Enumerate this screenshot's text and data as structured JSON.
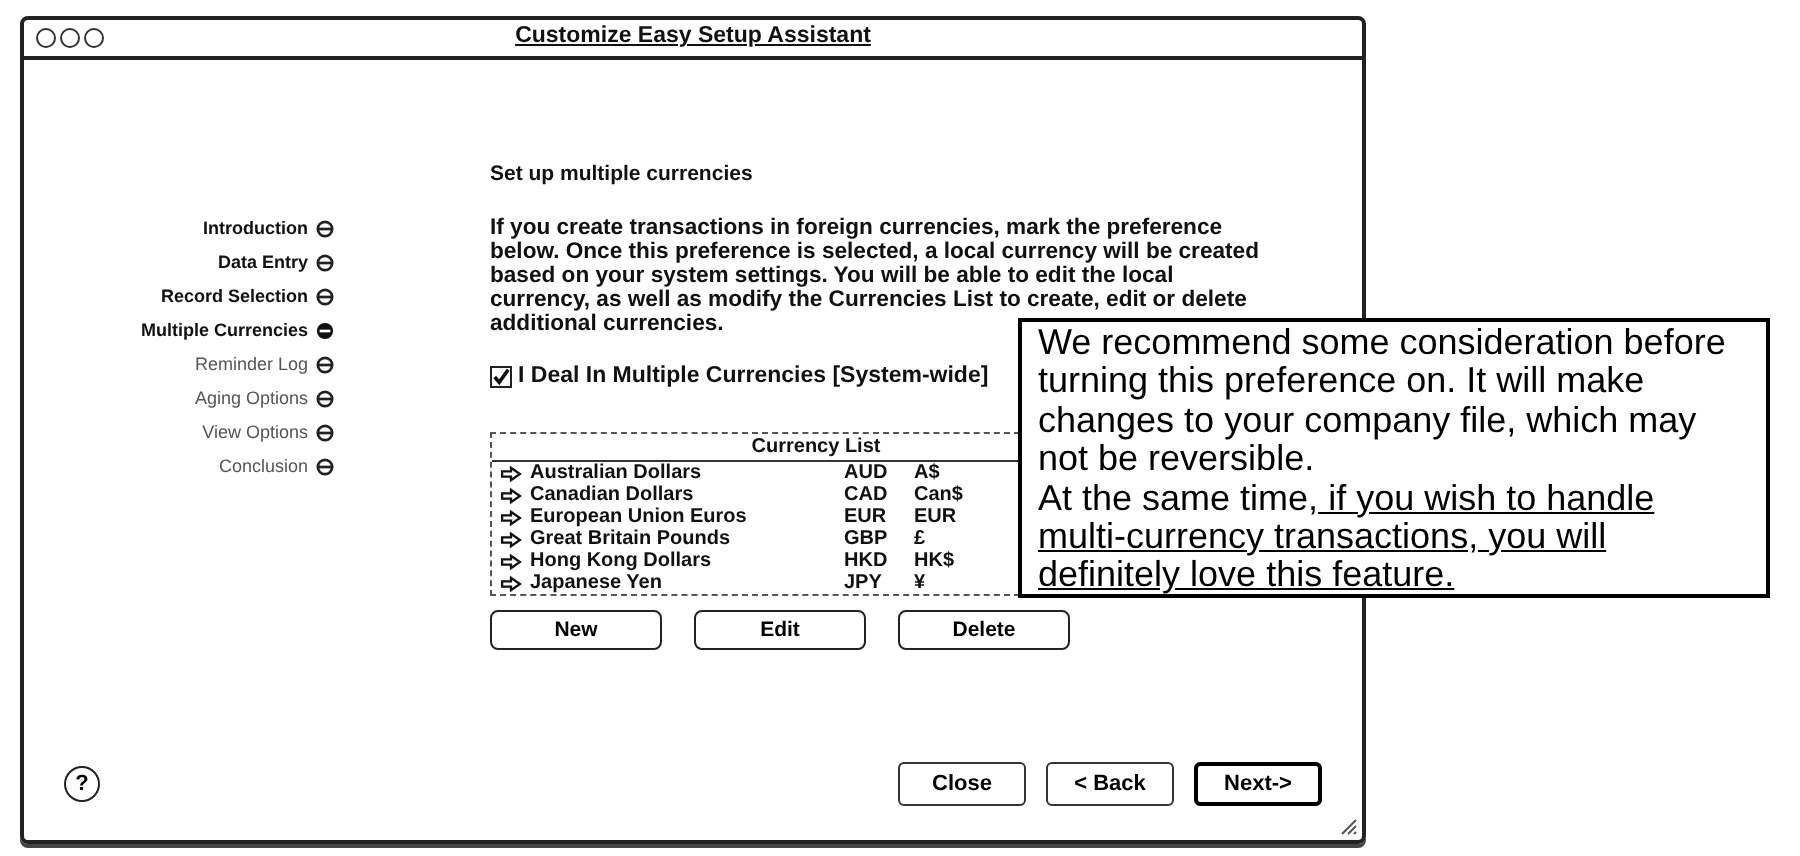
{
  "window": {
    "title": "Customize Easy Setup Assistant"
  },
  "sidebar": {
    "items": [
      {
        "label": "Introduction",
        "completed": true,
        "selected": false
      },
      {
        "label": "Data Entry",
        "completed": true,
        "selected": false
      },
      {
        "label": "Record Selection",
        "completed": true,
        "selected": false
      },
      {
        "label": "Multiple Currencies",
        "completed": true,
        "selected": true
      },
      {
        "label": "Reminder Log",
        "completed": false,
        "selected": false
      },
      {
        "label": "Aging Options",
        "completed": false,
        "selected": false
      },
      {
        "label": "View Options",
        "completed": false,
        "selected": false
      },
      {
        "label": "Conclusion",
        "completed": false,
        "selected": false
      }
    ]
  },
  "heading": "Set up multiple currencies",
  "description": [
    "If you create transactions in foreign currencies, mark the preference",
    "below. Once this preference is selected, a local currency will be created",
    "based on your system settings. You will be able to edit the local",
    "currency, as well as modify the Currencies List to create, edit or delete",
    "additional currencies."
  ],
  "preference": {
    "label": "I Deal In Multiple Currencies [System-wide]",
    "checked": true
  },
  "currency_list": {
    "title": "Currency List",
    "rows": [
      {
        "name": "Australian Dollars",
        "code": "AUD",
        "symbol": "A$"
      },
      {
        "name": "Canadian Dollars",
        "code": "CAD",
        "symbol": "Can$"
      },
      {
        "name": "European Union Euros",
        "code": "EUR",
        "symbol": "EUR"
      },
      {
        "name": "Great Britain Pounds",
        "code": "GBP",
        "symbol": "£"
      },
      {
        "name": "Hong Kong Dollars",
        "code": "HKD",
        "symbol": "HK$"
      },
      {
        "name": "Japanese Yen",
        "code": "JPY",
        "symbol": "¥"
      }
    ]
  },
  "list_buttons": [
    "New",
    "Edit",
    "Delete"
  ],
  "help_button": "?",
  "footer_buttons": [
    {
      "label": "Close",
      "default": false
    },
    {
      "label": "< Back",
      "default": false
    },
    {
      "label": "Next->",
      "default": true
    }
  ],
  "callout": {
    "text": "We recommend some consideration before turning this preference on. It will make changes to your company file, which may not be reversible.",
    "text_2": "At the same time,",
    "underlined": " if you wish to handle multi-currency transactions, you will definitely love this feature."
  }
}
